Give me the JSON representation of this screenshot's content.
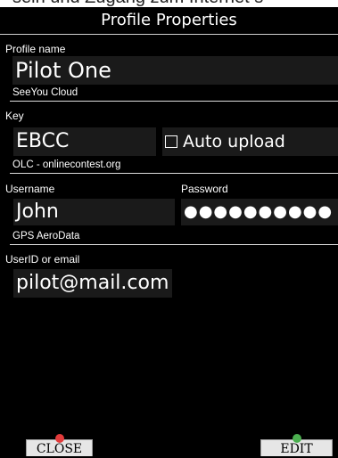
{
  "background_text": "sein und Zugang zum Internet s",
  "window": {
    "title": "Profile Properties"
  },
  "profile": {
    "label": "Profile name",
    "value": "Pilot One"
  },
  "seeyou": {
    "section_title": "SeeYou Cloud",
    "key_label": "Key",
    "key_value": "EBCC",
    "auto_upload_label": "Auto upload",
    "auto_upload_checked": false
  },
  "olc": {
    "section_title": "OLC - onlinecontest.org",
    "username_label": "Username",
    "username_value": "John",
    "password_label": "Password",
    "password_value": "●●●●●●●●●●"
  },
  "gps": {
    "section_title": "GPS AeroData",
    "user_label": "UserID or email",
    "user_value": "pilot@mail.com"
  },
  "buttons": {
    "close_label": "CLOSE",
    "edit_label": "EDIT"
  },
  "colors": {
    "close_icon": "#e23b3b",
    "edit_icon": "#4caf50"
  }
}
